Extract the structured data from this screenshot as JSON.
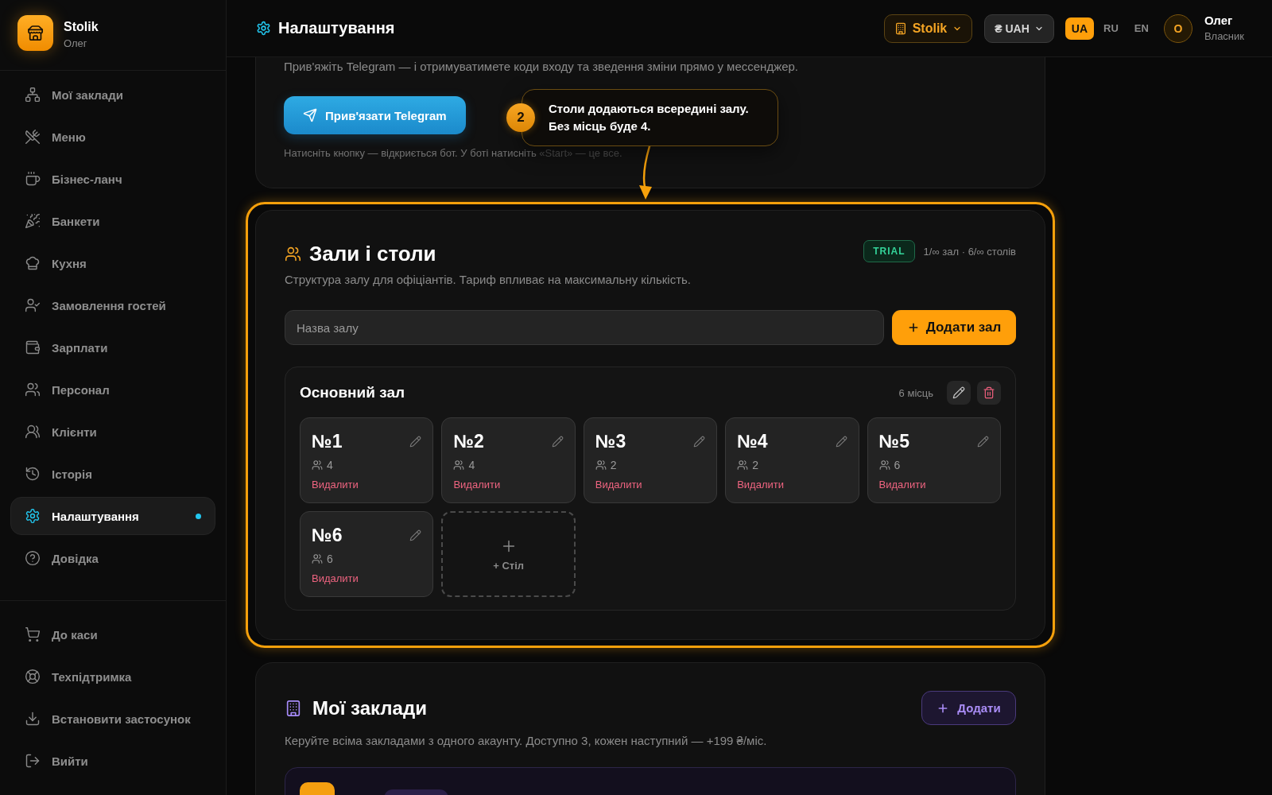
{
  "app": {
    "name": "Stolik",
    "user": "Олег"
  },
  "sidebar": {
    "items": [
      {
        "label": "Мої заклади",
        "selected": false
      },
      {
        "label": "Меню",
        "selected": false
      },
      {
        "label": "Бізнес-ланч",
        "selected": false
      },
      {
        "label": "Банкети",
        "selected": false
      },
      {
        "label": "Кухня",
        "selected": false
      },
      {
        "label": "Замовлення гостей",
        "selected": false
      },
      {
        "label": "Зарплати",
        "selected": false
      },
      {
        "label": "Персонал",
        "selected": false
      },
      {
        "label": "Клієнти",
        "selected": false
      },
      {
        "label": "Історія",
        "selected": false
      },
      {
        "label": "Налаштування",
        "selected": true
      },
      {
        "label": "Довідка",
        "selected": false
      }
    ],
    "footer_items": [
      {
        "label": "До каси",
        "selected": false
      },
      {
        "label": "Техпідтримка",
        "selected": false
      },
      {
        "label": "Встановити застосунок",
        "selected": false
      },
      {
        "label": "Вийти",
        "selected": false
      }
    ]
  },
  "header": {
    "title": "Налаштування",
    "venue_switch": {
      "label": "Stolik",
      "expanded": false
    },
    "currency_switch": {
      "label": "₴ UAH",
      "expanded": false
    },
    "languages": [
      {
        "label": "UA",
        "selected": true
      },
      {
        "label": "RU",
        "selected": false
      },
      {
        "label": "EN",
        "selected": false
      }
    ],
    "user": {
      "initial": "О",
      "name": "Олег",
      "role": "Власник"
    }
  },
  "telegram_card": {
    "description": "Прив'яжіть Telegram — і отримуватимете коди входу та зведення зміни прямо у мессенджер.",
    "button": "Прив'язати Telegram",
    "hint": "Натисніть кнопку — відкриється бот. У боті натисніть ",
    "hint_muted": "«Start» — це все."
  },
  "halls_card": {
    "title": "Зали і столи",
    "plan": "TRIAL",
    "limits": "1/∞ зал · 6/∞ столів",
    "description": "Структура залу для офіціантів. Тариф впливає на максимальну кількість.",
    "input": {
      "placeholder": "Назва залу"
    },
    "add_button": "Додати зал",
    "halls": [
      {
        "name": "Основний зал",
        "seats": "6 місць",
        "tables": [
          {
            "name": "№1",
            "seats": "4",
            "action": "Видалити"
          },
          {
            "name": "№2",
            "seats": "4",
            "action": "Видалити"
          },
          {
            "name": "№3",
            "seats": "2",
            "action": "Видалити"
          },
          {
            "name": "№4",
            "seats": "2",
            "action": "Видалити"
          },
          {
            "name": "№5",
            "seats": "6",
            "action": "Видалити"
          },
          {
            "name": "№6",
            "seats": "6",
            "action": "Видалити"
          }
        ],
        "add_table": "+ Стіл"
      }
    ]
  },
  "venues_card": {
    "title": "Мої заклади",
    "add_button": "Додати",
    "description": "Керуйте всіма закладами з одного акаунту. Доступно 3, кожен наступний — +199 ₴/міс."
  },
  "tour": {
    "step": "2",
    "lines": [
      "Столи додаються всередині залу.",
      "Без місць буде 4."
    ]
  }
}
